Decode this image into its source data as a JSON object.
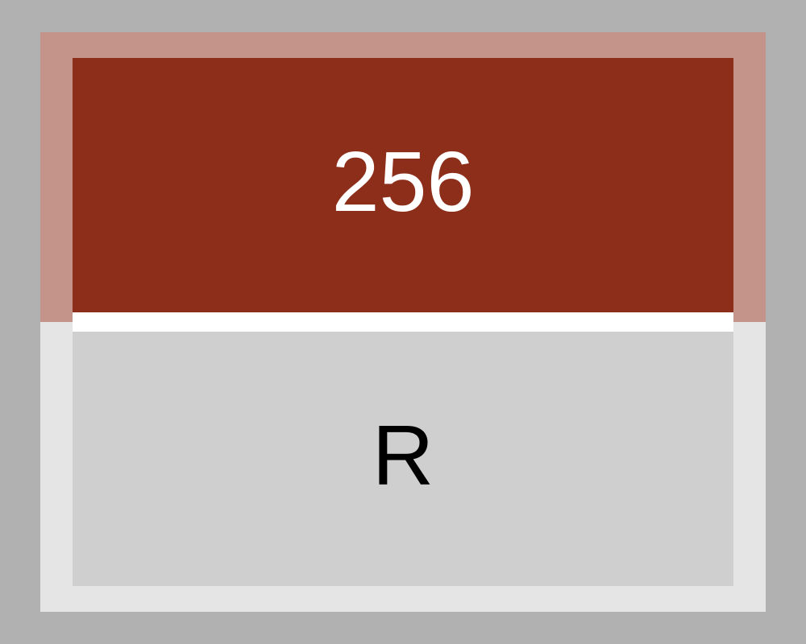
{
  "tile": {
    "value": "256",
    "label": "R",
    "colors": {
      "background": "#b1b1b1",
      "card": "#e5e5e5",
      "accent_bezel": "#c4948b",
      "accent": "#8c2e1a",
      "divider": "#ffffff",
      "lower_panel": "#cfcfcf",
      "value_text": "#ffffff",
      "label_text": "#000000"
    }
  }
}
